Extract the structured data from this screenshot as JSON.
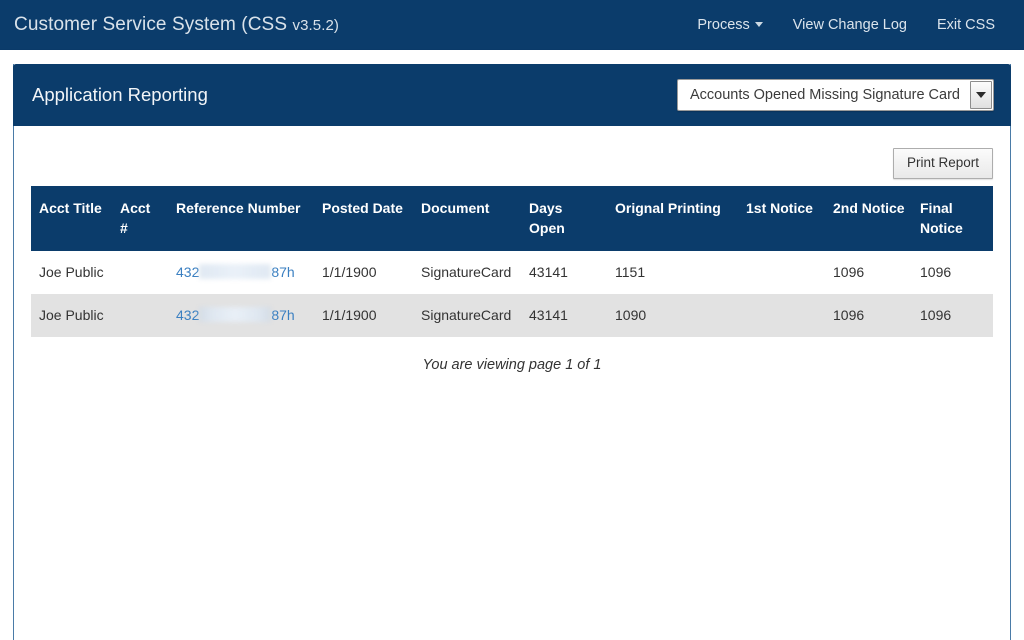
{
  "navbar": {
    "brand_name": "Customer Service System (CSS ",
    "brand_version": "v3.5.2)",
    "links": [
      {
        "label": "Process",
        "has_caret": true,
        "icon": "chevron-down-icon"
      },
      {
        "label": "View Change Log",
        "has_caret": false
      },
      {
        "label": "Exit CSS",
        "has_caret": false
      }
    ]
  },
  "panel": {
    "title": "Application Reporting",
    "report_select": {
      "selected": "Accounts Opened Missing Signature Card",
      "arrow_icon": "chevron-down-icon"
    },
    "print_button": "Print Report",
    "paging_text": "You are viewing page 1 of 1"
  },
  "table": {
    "columns": [
      "Acct Title",
      "Acct #",
      "Reference Number",
      "Posted Date",
      "Document",
      "Days Open",
      "Orignal Printing",
      "1st Notice",
      "2nd Notice",
      "Final Notice"
    ],
    "rows": [
      {
        "acct_title": "Joe Public",
        "acct_number": "",
        "reference_prefix": "432",
        "reference_suffix": "87h",
        "reference_redacted": true,
        "posted_date": "1/1/1900",
        "document": "SignatureCard",
        "days_open": "43141",
        "orignal_printing": "1151",
        "notice_1st": "",
        "notice_2nd": "1096",
        "notice_final": "1096"
      },
      {
        "acct_title": "Joe Public",
        "acct_number": "",
        "reference_prefix": "432",
        "reference_suffix": "87h",
        "reference_redacted": true,
        "posted_date": "1/1/1900",
        "document": "SignatureCard",
        "days_open": "43141",
        "orignal_printing": "1090",
        "notice_1st": "",
        "notice_2nd": "1096",
        "notice_final": "1096"
      }
    ]
  },
  "colors": {
    "navy": "#0b3c6b",
    "panel_border": "#4a7ba7",
    "link_blue": "#3a7fc1",
    "row_alt": "#e2e2e2"
  }
}
